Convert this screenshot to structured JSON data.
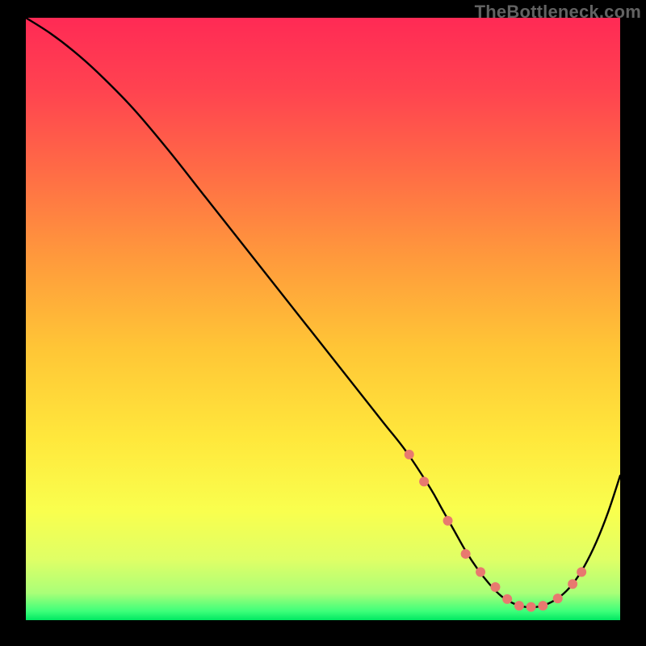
{
  "watermark": "TheBottleneck.com",
  "chart_data": {
    "type": "line",
    "title": "",
    "xlabel": "",
    "ylabel": "",
    "xlim": [
      0,
      100
    ],
    "ylim": [
      0,
      100
    ],
    "series": [
      {
        "name": "curve",
        "x": [
          0,
          4,
          8,
          12,
          18,
          24,
          30,
          36,
          42,
          48,
          54,
          60,
          64,
          68,
          70,
          72,
          74,
          76,
          78,
          80,
          82,
          84,
          86,
          88,
          90,
          92,
          94,
          96,
          98,
          100
        ],
        "values": [
          100,
          97.5,
          94.5,
          91,
          85,
          78,
          70.5,
          63,
          55.5,
          48,
          40.5,
          33,
          28,
          22,
          18.5,
          15,
          11.5,
          8.5,
          6,
          4,
          2.8,
          2.2,
          2.2,
          2.8,
          4,
          6,
          9,
          13,
          18,
          24
        ]
      }
    ],
    "markers": {
      "name": "bottleneck-points",
      "color": "#e8796f",
      "x": [
        64.5,
        67,
        71,
        74,
        76.5,
        79,
        81,
        83,
        85,
        87,
        89.5,
        92,
        93.5
      ],
      "values": [
        27.5,
        23,
        16.5,
        11,
        8,
        5.5,
        3.5,
        2.4,
        2.2,
        2.4,
        3.6,
        6,
        8
      ]
    },
    "gradient_stops": [
      {
        "offset": 0.0,
        "color": "#ff2a55"
      },
      {
        "offset": 0.12,
        "color": "#ff4350"
      },
      {
        "offset": 0.25,
        "color": "#ff6a46"
      },
      {
        "offset": 0.4,
        "color": "#ff9a3c"
      },
      {
        "offset": 0.55,
        "color": "#ffc636"
      },
      {
        "offset": 0.7,
        "color": "#ffe83c"
      },
      {
        "offset": 0.82,
        "color": "#f9ff4e"
      },
      {
        "offset": 0.9,
        "color": "#dfff66"
      },
      {
        "offset": 0.955,
        "color": "#aaff78"
      },
      {
        "offset": 0.985,
        "color": "#3eff7a"
      },
      {
        "offset": 1.0,
        "color": "#00e862"
      }
    ]
  }
}
